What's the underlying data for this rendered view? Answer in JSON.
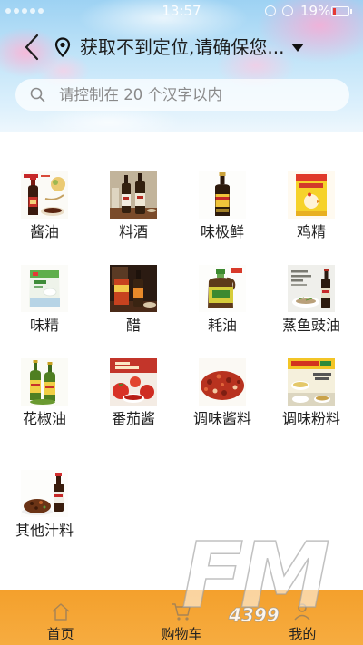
{
  "status_bar": {
    "time": "13:57",
    "battery": "19%",
    "battery_color": "#e53935"
  },
  "header": {
    "back_icon": "chevron-left-icon",
    "location_icon": "location-pin-icon",
    "location_text": "获取不到定位,请确保您...",
    "dropdown_icon": "triangle-down-icon"
  },
  "search": {
    "icon": "search-icon",
    "placeholder": "请控制在 20 个汉字以内",
    "value": ""
  },
  "categories": [
    {
      "label": "酱油",
      "image": "soy-sauce-bottle"
    },
    {
      "label": "料酒",
      "image": "cooking-wine-bottles"
    },
    {
      "label": "味极鲜",
      "image": "weijixian-bottle"
    },
    {
      "label": "鸡精",
      "image": "chicken-essence-bag"
    },
    {
      "label": "味精",
      "image": "msg-bag"
    },
    {
      "label": "醋",
      "image": "vinegar-bottle"
    },
    {
      "label": "耗油",
      "image": "oyster-sauce-jug"
    },
    {
      "label": "蒸鱼豉油",
      "image": "steamed-fish-soy-sauce"
    },
    {
      "label": "花椒油",
      "image": "sichuan-pepper-oil-bottles"
    },
    {
      "label": "番茄酱",
      "image": "ketchup-tomatoes"
    },
    {
      "label": "调味酱料",
      "image": "chili-sauce"
    },
    {
      "label": "调味粉料",
      "image": "seasoning-powder-pack"
    },
    {
      "label": "其他汁料",
      "image": "other-sauce-bottle"
    }
  ],
  "bottom_nav": {
    "items": [
      {
        "label": "首页",
        "icon": "home-icon"
      },
      {
        "label": "购物车",
        "icon": "cart-icon"
      },
      {
        "label": "我的",
        "icon": "user-icon"
      }
    ]
  },
  "watermark": {
    "brand": "FM",
    "number": "4399"
  },
  "colors": {
    "bottom_nav_orange": "#f5a12f",
    "header_sky_blue": "#9dd2f3",
    "label_text": "#222222",
    "placeholder_text": "#8a8a8a"
  }
}
